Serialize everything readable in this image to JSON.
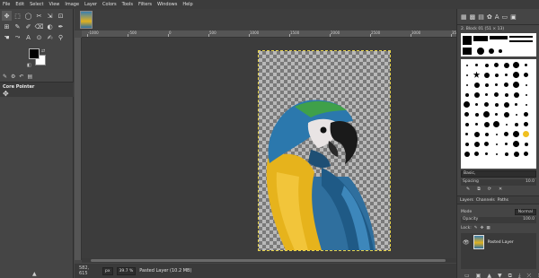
{
  "menu": [
    "File",
    "Edit",
    "Select",
    "View",
    "Image",
    "Layer",
    "Colors",
    "Tools",
    "Filters",
    "Windows",
    "Help"
  ],
  "tools": [
    {
      "glyph": "✥",
      "name": "move-tool-icon"
    },
    {
      "glyph": "⬚",
      "name": "rect-select-icon"
    },
    {
      "glyph": "◯",
      "name": "lasso-icon"
    },
    {
      "glyph": "✂",
      "name": "scissors-icon"
    },
    {
      "glyph": "⇲",
      "name": "crop-icon"
    },
    {
      "glyph": "⊡",
      "name": "unified-transform-icon"
    },
    {
      "glyph": "⊞",
      "name": "cage-transform-icon"
    },
    {
      "glyph": "✎",
      "name": "paintbrush-icon"
    },
    {
      "glyph": "✐",
      "name": "pencil-icon"
    },
    {
      "glyph": "⌫",
      "name": "eraser-icon"
    },
    {
      "glyph": "◐",
      "name": "bucket-fill-icon"
    },
    {
      "glyph": "✒",
      "name": "ink-icon"
    },
    {
      "glyph": "☚",
      "name": "smudge-icon"
    },
    {
      "glyph": "⤳",
      "name": "path-icon"
    },
    {
      "glyph": "A",
      "name": "text-tool-icon"
    },
    {
      "glyph": "⊙",
      "name": "clone-icon"
    },
    {
      "glyph": "✍",
      "name": "color-picker-icon"
    },
    {
      "glyph": "⚲",
      "name": "zoom-icon"
    }
  ],
  "toolbox": {
    "tabs": [
      "✎",
      "⚙",
      "↶",
      "▤"
    ],
    "options_title": "Core Pointer",
    "options_icon": "✥",
    "bottom_icon": "▲",
    "swap": "⇄",
    "reset": "◧"
  },
  "ruler": {
    "ticks": [
      "-1000",
      "-500",
      "0",
      "500",
      "1000",
      "1500",
      "2000",
      "2500",
      "3000",
      "3500"
    ]
  },
  "status": {
    "coords": "582, 615",
    "unit": "px",
    "zoom": "39.7 %",
    "message": "Pasted Layer (10.2 MB)"
  },
  "brushes": {
    "tabs": [
      "▦",
      "▩",
      "▤",
      "✿",
      "A",
      "▭",
      "▣"
    ],
    "title": "2. Block 01 (51 × 13)",
    "tag": "Basic,",
    "spacing_label": "Spacing",
    "spacing_value": "10.0",
    "actions": [
      "✎",
      "⧉",
      "⟳",
      "✕"
    ]
  },
  "layers": {
    "tabs": [
      "Layers",
      "Channels",
      "Paths"
    ],
    "mode_label": "Mode",
    "mode_value": "Normal",
    "opacity_label": "Opacity",
    "opacity_value": "100.0",
    "lock_label": "Lock:",
    "lock_icons": [
      "✎",
      "✥",
      "▦"
    ],
    "items": [
      {
        "name": "Pasted Layer",
        "visible": true
      }
    ],
    "actions": [
      "▭",
      "▣",
      "▲",
      "▼",
      "⧉",
      "⤓",
      "⤫",
      "✕"
    ]
  }
}
